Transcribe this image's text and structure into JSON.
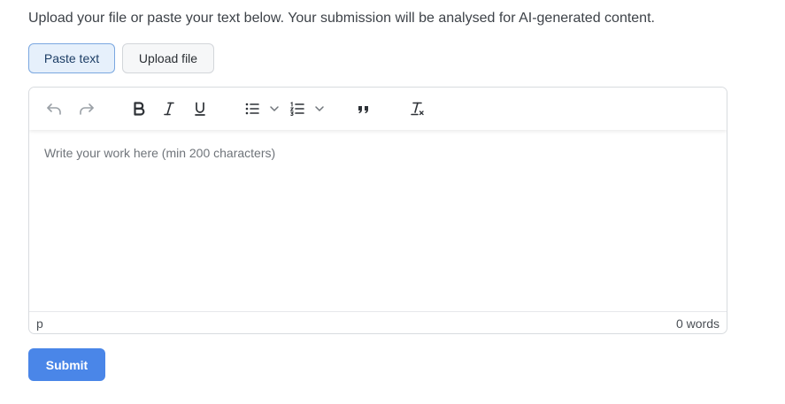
{
  "instructions": "Upload your file or paste your text below. Your submission will be analysed for AI-generated content.",
  "modes": {
    "paste_label": "Paste text",
    "upload_label": "Upload file",
    "active": "paste"
  },
  "toolbar": {
    "buttons": [
      {
        "name": "undo-icon",
        "enabled": false
      },
      {
        "name": "redo-icon",
        "enabled": false
      },
      {
        "name": "bold-icon",
        "glyph": "B"
      },
      {
        "name": "italic-icon",
        "glyph": "I"
      },
      {
        "name": "underline-icon",
        "glyph": "U"
      },
      {
        "name": "bullet-list-icon"
      },
      {
        "name": "chevron-down-icon"
      },
      {
        "name": "numbered-list-icon"
      },
      {
        "name": "chevron-down-icon"
      },
      {
        "name": "blockquote-icon"
      },
      {
        "name": "clear-formatting-icon"
      }
    ]
  },
  "editor": {
    "placeholder": "Write your work here (min 200 characters)",
    "path": "p",
    "word_count": "0 words"
  },
  "submit_label": "Submit",
  "colors": {
    "accent": "#4a86e8",
    "active_tab_bg": "#e6f0fb",
    "active_tab_border": "#7aa7e0"
  }
}
